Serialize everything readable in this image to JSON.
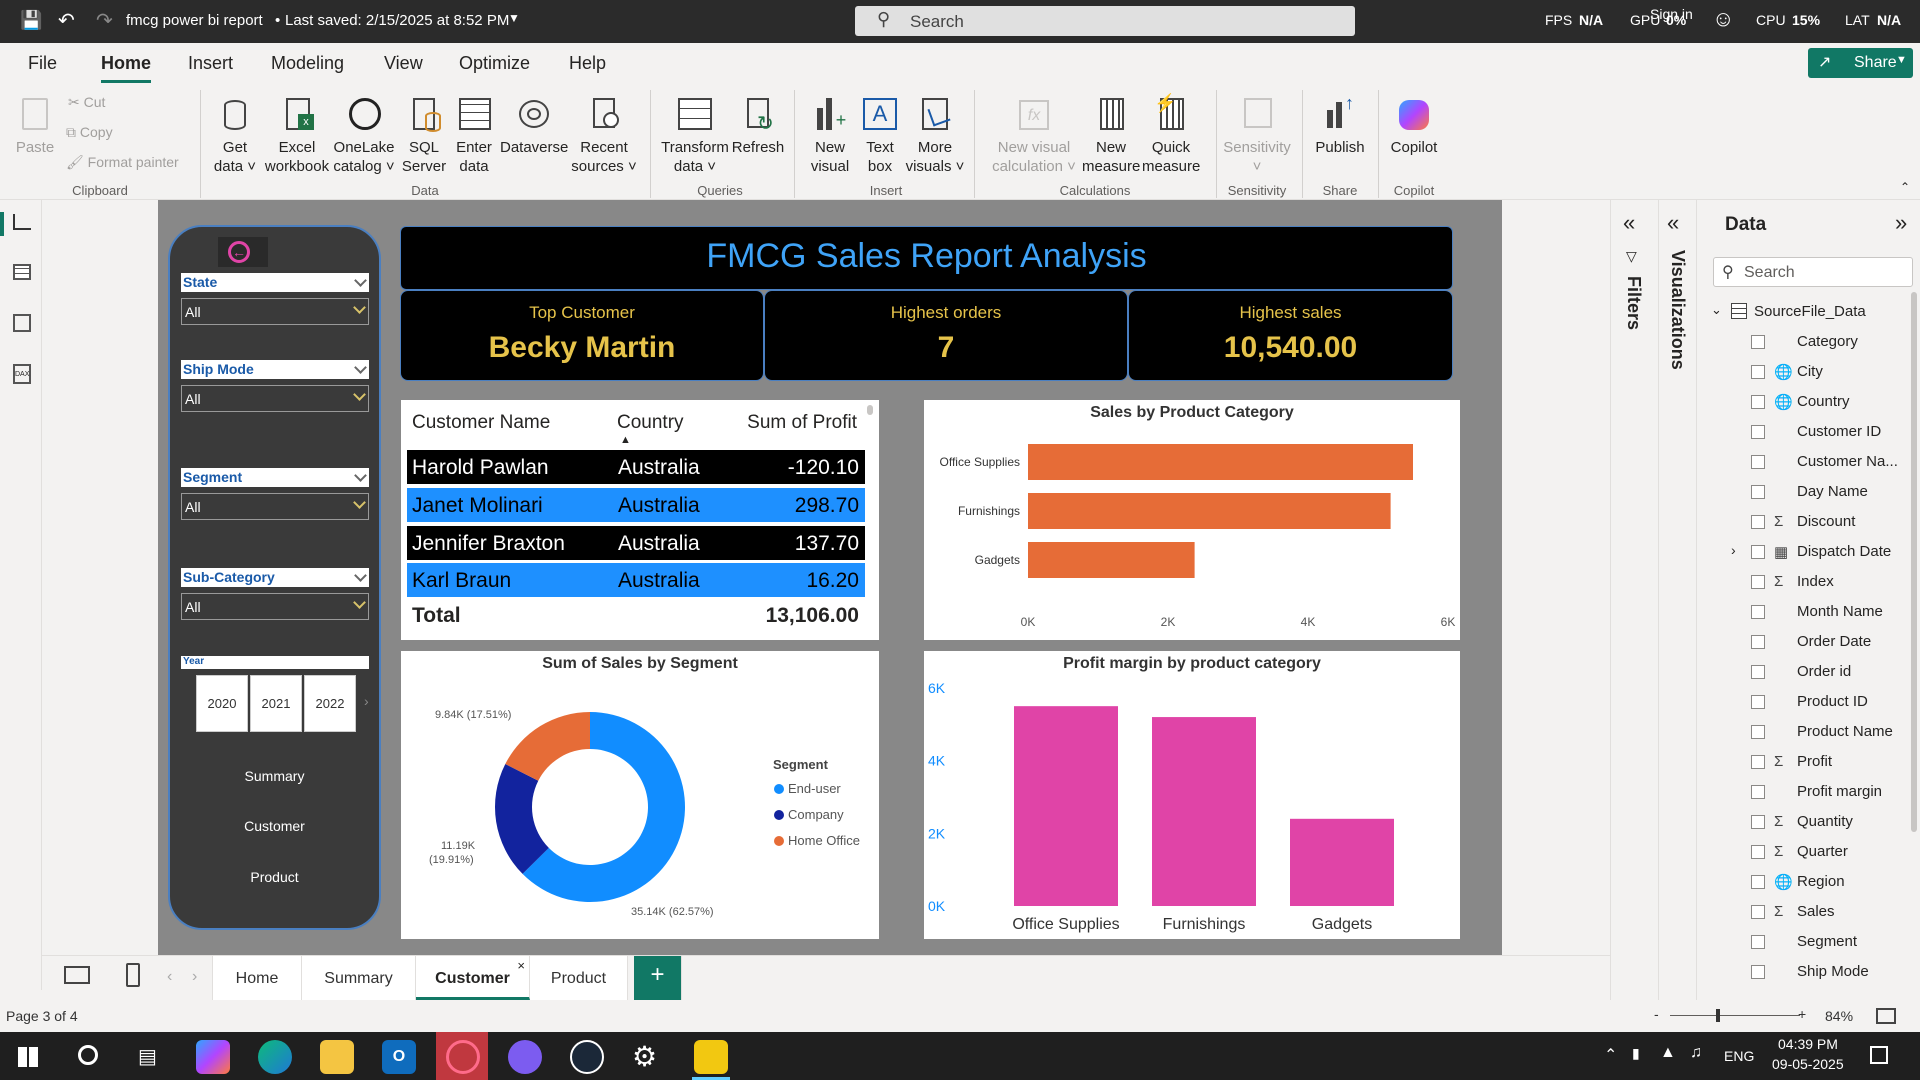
{
  "titlebar": {
    "title": "fmcg power bi report",
    "saved": "Last saved: 2/15/2025 at 8:52 PM",
    "search_placeholder": "Search",
    "fps_label": "FPS",
    "fps_value": "N/A",
    "gpu_label": "GPU",
    "gpu_value": "0%",
    "sign_in": "Sign in",
    "cpu_label": "CPU",
    "cpu_value": "15%",
    "lat_label": "LAT",
    "lat_value": "N/A"
  },
  "menu": {
    "items": [
      "File",
      "Home",
      "Insert",
      "Modeling",
      "View",
      "Optimize",
      "Help"
    ],
    "active": "Home",
    "share": "Share"
  },
  "ribbon": {
    "clipboard": {
      "paste": "Paste",
      "cut": "Cut",
      "copy": "Copy",
      "format_painter": "Format painter",
      "group": "Clipboard"
    },
    "data": {
      "get_data": [
        "Get",
        "data"
      ],
      "excel": [
        "Excel",
        "workbook"
      ],
      "onelake": [
        "OneLake",
        "catalog"
      ],
      "sql": [
        "SQL",
        "Server"
      ],
      "enter": [
        "Enter",
        "data"
      ],
      "dataverse": "Dataverse",
      "recent": [
        "Recent",
        "sources"
      ],
      "group": "Data"
    },
    "queries": {
      "transform": [
        "Transform",
        "data"
      ],
      "refresh": "Refresh",
      "group": "Queries"
    },
    "insert": {
      "new_visual": [
        "New",
        "visual"
      ],
      "text_box": [
        "Text",
        "box"
      ],
      "more_visuals": [
        "More",
        "visuals"
      ],
      "group": "Insert"
    },
    "calculations": {
      "new_visual_calc": [
        "New visual",
        "calculation"
      ],
      "new_measure": [
        "New",
        "measure"
      ],
      "quick_measure": [
        "Quick",
        "measure"
      ],
      "group": "Calculations"
    },
    "sensitivity": {
      "label": "Sensitivity",
      "group": "Sensitivity"
    },
    "share": {
      "publish": "Publish",
      "group": "Share"
    },
    "copilot": {
      "label": "Copilot",
      "group": "Copilot"
    }
  },
  "slicers": {
    "state": {
      "label": "State",
      "value": "All"
    },
    "ship_mode": {
      "label": "Ship Mode",
      "value": "All"
    },
    "segment": {
      "label": "Segment",
      "value": "All"
    },
    "sub_category": {
      "label": "Sub-Category",
      "value": "All"
    },
    "year": {
      "label": "Year",
      "options": [
        "2020",
        "2021",
        "2022"
      ]
    },
    "nav": [
      "Summary",
      "Customer",
      "Product"
    ]
  },
  "report": {
    "title": "FMCG Sales Report Analysis",
    "kpis": [
      {
        "label": "Top Customer",
        "value": "Becky Martin"
      },
      {
        "label": "Highest orders",
        "value": "7"
      },
      {
        "label": "Highest sales",
        "value": "10,540.00"
      }
    ],
    "table": {
      "headers": [
        "Customer Name",
        "Country",
        "Sum of Profit"
      ],
      "rows": [
        [
          "Harold Pawlan",
          "Australia",
          "-120.10"
        ],
        [
          "Janet Molinari",
          "Australia",
          "298.70"
        ],
        [
          "Jennifer Braxton",
          "Australia",
          "137.70"
        ],
        [
          "Karl Braun",
          "Australia",
          "16.20"
        ]
      ],
      "total_label": "Total",
      "total_value": "13,106.00"
    }
  },
  "chart_data": [
    {
      "type": "bar",
      "orientation": "horizontal",
      "title": "Sales by Product Category",
      "categories": [
        "Office Supplies",
        "Furnishings",
        "Gadgets"
      ],
      "values": [
        5500,
        5180,
        2380
      ],
      "xlim": [
        0,
        6000
      ],
      "ticks": [
        "0K",
        "2K",
        "4K",
        "6K"
      ],
      "color": "#e66c37"
    },
    {
      "type": "pie",
      "title": "Sum of Sales by Segment",
      "legend_title": "Segment",
      "legend_position": "right",
      "labels": [
        "End-user",
        "Company",
        "Home Office"
      ],
      "values": [
        35.14,
        11.19,
        9.84
      ],
      "data_labels": [
        "35.14K (62.57%)",
        "11.19K (19.91%)",
        "9.84K (17.51%)"
      ],
      "colors": [
        "#118dff",
        "#12239e",
        "#e66c37"
      ]
    },
    {
      "type": "bar",
      "title": "Profit margin by product category",
      "categories": [
        "Office Supplies",
        "Furnishings",
        "Gadgets"
      ],
      "values": [
        5500,
        5200,
        2400
      ],
      "ylim": [
        0,
        6000
      ],
      "ticks": [
        "0K",
        "2K",
        "4K",
        "6K"
      ],
      "color": "#e044a7"
    }
  ],
  "pages": {
    "tabs": [
      "Home",
      "Summary",
      "Customer",
      "Product"
    ],
    "active": "Customer",
    "status": "Page 3 of 4",
    "zoom": "84%"
  },
  "panes": {
    "filters": "Filters",
    "visualizations": "Visualizations",
    "data_title": "Data",
    "search_placeholder": "Search",
    "table_name": "SourceFile_Data",
    "fields": [
      {
        "name": "Category",
        "icon": ""
      },
      {
        "name": "City",
        "icon": "globe"
      },
      {
        "name": "Country",
        "icon": "globe"
      },
      {
        "name": "Customer ID",
        "icon": ""
      },
      {
        "name": "Customer Na...",
        "icon": ""
      },
      {
        "name": "Day Name",
        "icon": ""
      },
      {
        "name": "Discount",
        "icon": "sigma"
      },
      {
        "name": "Dispatch Date",
        "icon": "calendar"
      },
      {
        "name": "Index",
        "icon": "sigma"
      },
      {
        "name": "Month Name",
        "icon": ""
      },
      {
        "name": "Order Date",
        "icon": ""
      },
      {
        "name": "Order id",
        "icon": ""
      },
      {
        "name": "Product ID",
        "icon": ""
      },
      {
        "name": "Product Name",
        "icon": ""
      },
      {
        "name": "Profit",
        "icon": "sigma"
      },
      {
        "name": "Profit margin",
        "icon": ""
      },
      {
        "name": "Quantity",
        "icon": "sigma"
      },
      {
        "name": "Quarter",
        "icon": "sigma"
      },
      {
        "name": "Region",
        "icon": "globe"
      },
      {
        "name": "Sales",
        "icon": "sigma"
      },
      {
        "name": "Segment",
        "icon": ""
      },
      {
        "name": "Ship Mode",
        "icon": ""
      }
    ]
  },
  "taskbar": {
    "lang": "ENG",
    "time": "04:39 PM",
    "date": "09-05-2025"
  }
}
